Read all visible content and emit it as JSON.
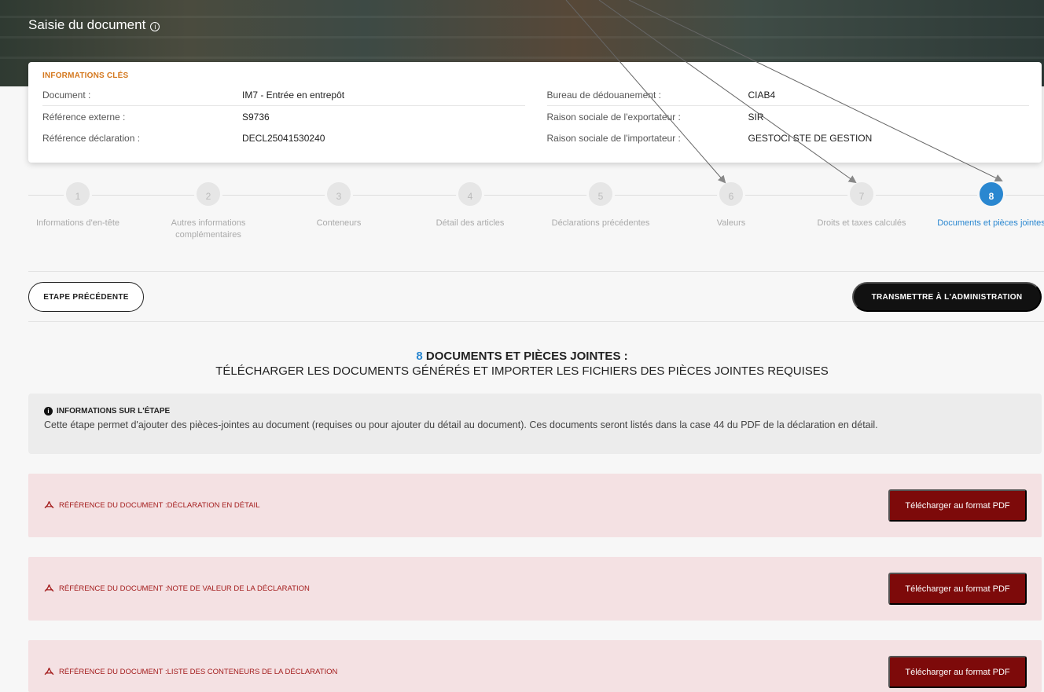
{
  "header": {
    "title": "Saisie du document",
    "info_icon": "info-icon"
  },
  "key_info": {
    "title": "INFORMATIONS CLÉS",
    "left": [
      {
        "label": "Document :",
        "value": "IM7 - Entrée en entrepôt"
      },
      {
        "label": "Référence externe :",
        "value": "S9736"
      },
      {
        "label": "Référence déclaration :",
        "value": "DECL25041530240"
      }
    ],
    "right": [
      {
        "label": "Bureau de dédouanement :",
        "value": "CIAB4"
      },
      {
        "label": "Raison sociale de l'exportateur :",
        "value": "SIR"
      },
      {
        "label": "Raison sociale de l'importateur :",
        "value": "GESTOCI STE DE GESTION"
      }
    ]
  },
  "steps": [
    {
      "num": "1",
      "label": "Informations d'en-tête"
    },
    {
      "num": "2",
      "label": "Autres informations complémentaires"
    },
    {
      "num": "3",
      "label": "Conteneurs"
    },
    {
      "num": "4",
      "label": "Détail des articles"
    },
    {
      "num": "5",
      "label": "Déclarations précédentes"
    },
    {
      "num": "6",
      "label": "Valeurs"
    },
    {
      "num": "7",
      "label": "Droits et taxes calculés"
    },
    {
      "num": "8",
      "label": "Documents et pièces jointes"
    }
  ],
  "active_step": "8",
  "actions": {
    "prev_label": "ETAPE PRÉCÉDENTE",
    "send_label": "TRANSMETTRE À L'ADMINISTRATION"
  },
  "section": {
    "number": "8",
    "title": "DOCUMENTS ET PIÈCES JOINTES :",
    "subtitle": "TÉLÉCHARGER LES DOCUMENTS GÉNÉRÉS ET IMPORTER LES FICHIERS DES PIÈCES JOINTES REQUISES"
  },
  "step_info": {
    "title": "INFORMATIONS SUR L'ÉTAPE",
    "text": "Cette étape permet d'ajouter des pièces-jointes au document (requises ou pour ajouter du détail au document). Ces documents seront listés dans la case 44 du PDF de la déclaration en détail."
  },
  "documents": [
    {
      "label": "RÉFÉRENCE DU DOCUMENT :DÉCLARATION EN DÉTAIL",
      "button": "Télécharger au format PDF"
    },
    {
      "label": "RÉFÉRENCE DU DOCUMENT :NOTE DE VALEUR DE LA DÉCLARATION",
      "button": "Télécharger au format PDF"
    },
    {
      "label": "RÉFÉRENCE DU DOCUMENT :LISTE DES CONTENEURS DE LA DÉCLARATION",
      "button": "Télécharger au format PDF"
    }
  ],
  "colors": {
    "accent": "#2a87d0",
    "key_title": "#d4781e",
    "doc_bg": "#f4e1e3",
    "doc_btn": "#7d0a0a",
    "doc_text": "#a31c1c"
  }
}
